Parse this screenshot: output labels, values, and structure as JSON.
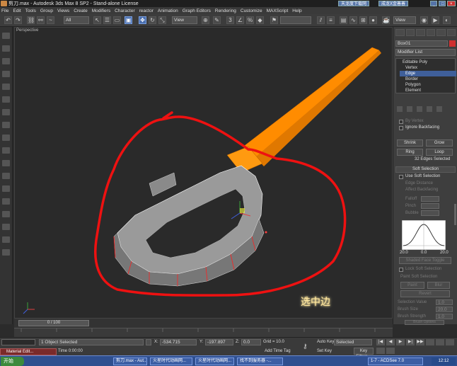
{
  "titlebar": {
    "title": "剪刀.max - Autodesk 3ds Max 8 SP2  - Stand-alone License",
    "btn1": "天龙度下载网",
    "btn2": "成龙X金善善"
  },
  "menu": [
    "File",
    "Edit",
    "Tools",
    "Group",
    "Views",
    "Create",
    "Modifiers",
    "Character",
    "reactor",
    "Animation",
    "Graph Editors",
    "Rendering",
    "Customize",
    "MAXScript",
    "Help"
  ],
  "toolbar": {
    "selection_filter": "All",
    "ref_coord": "View",
    "named_sel": "Create Selection Set"
  },
  "viewport": {
    "label": "Perspective",
    "annotation": "选中边"
  },
  "command_panel": {
    "object_name": "Box01",
    "modifier_list": "Modifier List",
    "stack": [
      "Editable Poly",
      "Vertex",
      "Edge",
      "Border",
      "Polygon",
      "Element"
    ],
    "selected_stack": "Edge",
    "by_vertex": "By Vertex",
    "ignore_backfacing": "Ignore Backfacing",
    "shrink": "Shrink",
    "grow": "Grow",
    "ring": "Ring",
    "loop": "Loop",
    "sel_count": "32 Edges Selected",
    "soft_sel_title": "Soft Selection",
    "use_soft": "Use Soft Selection",
    "edge_distance": "Edge Distance",
    "affect_backfacing": "Affect Backfacing",
    "falloff": "Falloff",
    "pinch": "Pinch",
    "bubble": "Bubble",
    "curve_labels": [
      "20.0",
      "0.0",
      "20.0"
    ],
    "shaded_face_toggle": "Shaded Face Toggle",
    "lock_soft": "Lock Soft Selection",
    "paint_soft": "Paint Soft Selection",
    "paint": "Paint",
    "blur": "Blur",
    "revert": "Revert",
    "sel_value": "Selection Value",
    "brush_size": "Brush Size",
    "brush_strength": "Brush Strength",
    "brush_options": "Brush Options",
    "val_sel": "1.0",
    "val_size": "20.0",
    "val_str": "1.0"
  },
  "timeline": {
    "frame": "0 / 100"
  },
  "status": {
    "maxscript": "Material Edit...",
    "objects_selected": "1 Object Selected",
    "time": "Time  0:00:00",
    "x_label": "X:",
    "y_label": "Y:",
    "z_label": "Z:",
    "x": "-534.715",
    "y": "-197.897",
    "z": "0.0",
    "grid": "Grid = 10.0",
    "add_time_tag": "Add Time Tag",
    "auto_key": "Auto Key",
    "set_key": "Set Key",
    "selected": "Selected",
    "key_filters": "Key Filters..."
  },
  "taskbar": {
    "start": "开始",
    "tasks": [
      "剪刀.max - Aut...",
      "火星时代动画网...",
      "火星时代动画网...",
      "找不到服务器 -...",
      "1-7 - ACDSee 7.0"
    ],
    "clock": "12:12"
  },
  "colors": {
    "accent": "#3f5f9a",
    "orange": "#ff8c00",
    "red_lasso": "#ee1111",
    "annotation": "#ffe9a0"
  }
}
